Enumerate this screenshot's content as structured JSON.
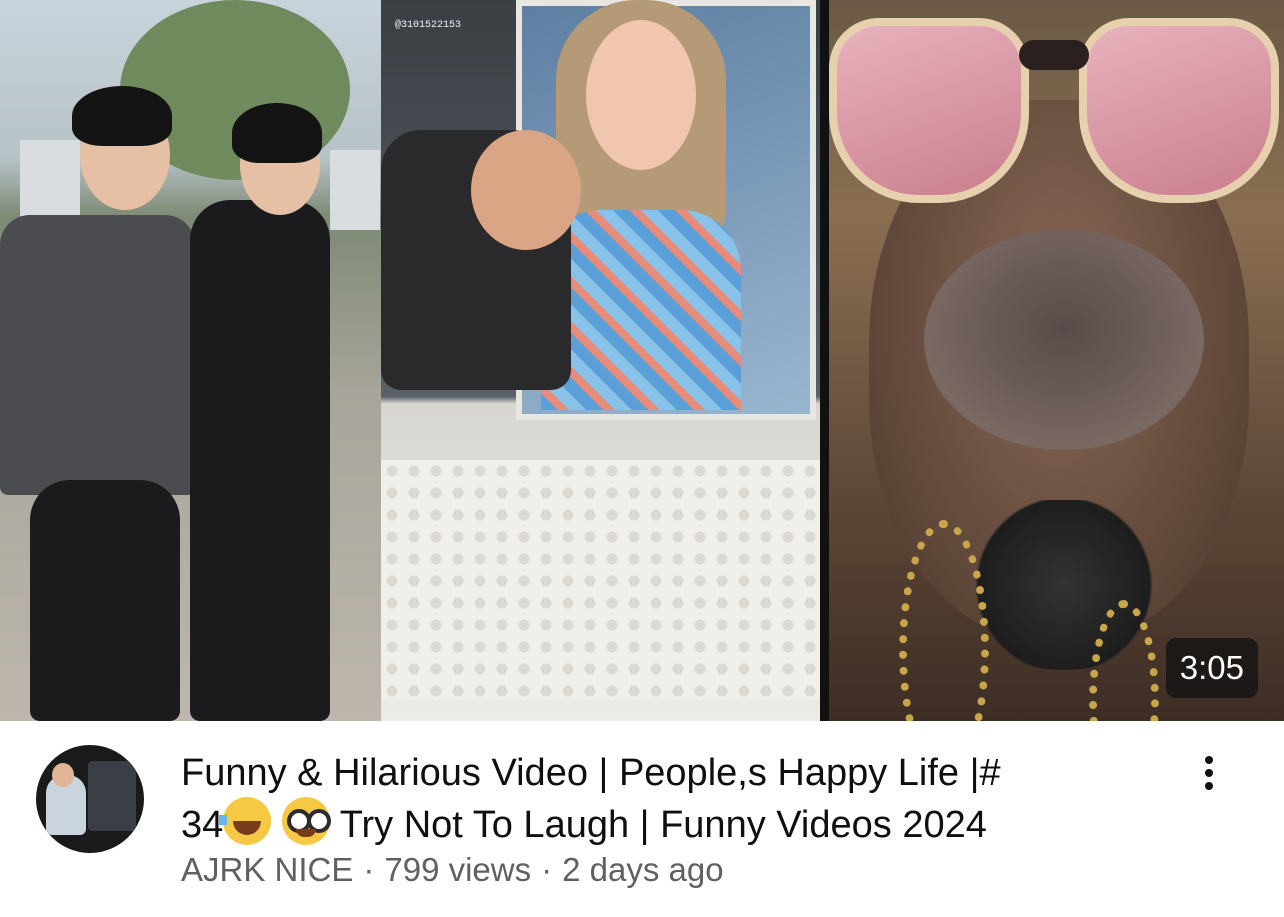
{
  "video": {
    "duration": "3:05",
    "title_line1": "Funny & Hilarious Video | People,s Happy Life |#",
    "title_line2_prefix": "34",
    "title_emojis": [
      "face-with-tears-of-joy",
      "nerd-face"
    ],
    "title_line2_suffix": "Try Not To Laugh | Funny Videos 2024",
    "watermark": "@3101522153"
  },
  "channel": {
    "name": "AJRK NICE"
  },
  "stats": {
    "views": "799 views",
    "age": "2 days ago",
    "separator": "·"
  },
  "icons": {
    "more": "more-vertical-icon"
  }
}
